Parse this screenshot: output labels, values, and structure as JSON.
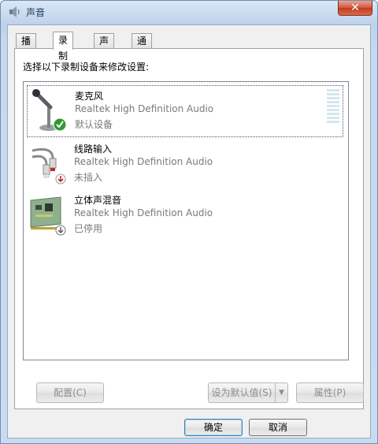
{
  "window": {
    "title": "声音",
    "close_label": "✕"
  },
  "tabs": [
    {
      "label": "播放"
    },
    {
      "label": "录制"
    },
    {
      "label": "声音"
    },
    {
      "label": "通信"
    }
  ],
  "panel": {
    "instruction": "选择以下录制设备来修改设置:"
  },
  "devices": [
    {
      "name": "麦克风",
      "description": "Realtek High Definition Audio",
      "status": "默认设备",
      "icon": "microphone-icon",
      "badge": "check-badge-icon"
    },
    {
      "name": "线路输入",
      "description": "Realtek High Definition Audio",
      "status": "未插入",
      "icon": "audio-cable-icon",
      "badge": "unplugged-badge-icon"
    },
    {
      "name": "立体声混音",
      "description": "Realtek High Definition Audio",
      "status": "已停用",
      "icon": "sound-card-icon",
      "badge": "disabled-badge-icon"
    }
  ],
  "buttons": {
    "configure": "配置(C)",
    "set_default": "设为默认值(S)",
    "properties": "属性(P)",
    "ok": "确定",
    "cancel": "取消"
  },
  "colors": {
    "check_green": "#2f9a2f",
    "unplugged_red": "#c8282c",
    "disabled_gray": "#6a6a6a"
  }
}
